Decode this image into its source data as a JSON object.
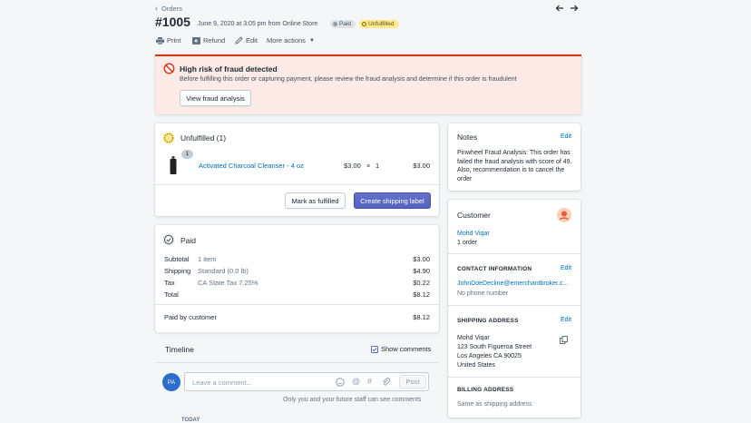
{
  "breadcrumb": {
    "label": "Orders"
  },
  "order": {
    "number": "#1005",
    "meta": "June 9, 2020 at 3:05 pm from Online Store",
    "badge_paid": "Paid",
    "badge_fulfillment": "Unfulfilled"
  },
  "actions": {
    "print": "Print",
    "refund": "Refund",
    "edit": "Edit",
    "more": "More actions"
  },
  "fraud": {
    "title": "High risk of fraud detected",
    "body": "Before fulfilling this order or capturing payment, please review the fraud analysis and determine if this order is fraudulent",
    "button": "View fraud analysis"
  },
  "unfulfilled": {
    "title": "Unfulfilled (1)",
    "item": {
      "qty_badge": "1",
      "name": "Activated Charcoal Cleanser - 4 oz",
      "price": "$3.00",
      "times": "×",
      "qty": "1",
      "total": "$3.00"
    },
    "mark_button": "Mark as fulfilled",
    "label_button": "Create shipping label"
  },
  "paid": {
    "title": "Paid",
    "rows": [
      {
        "label": "Subtotal",
        "detail": "1 item",
        "amount": "$3.00"
      },
      {
        "label": "Shipping",
        "detail": "Standard (0.0 lb)",
        "amount": "$4.90"
      },
      {
        "label": "Tax",
        "detail": "CA State Tax 7.25%",
        "amount": "$0.22"
      },
      {
        "label": "Total",
        "detail": "",
        "amount": "$8.12"
      }
    ],
    "paid_by_label": "Paid by customer",
    "paid_by_amount": "$8.12"
  },
  "timeline": {
    "title": "Timeline",
    "show_comments": "Show comments",
    "avatar": "PA",
    "placeholder": "Leave a comment...",
    "post": "Post",
    "hint": "Only you and your future staff can see comments",
    "today": "TODAY"
  },
  "notes": {
    "title": "Notes",
    "edit": "Edit",
    "text": "Pinwheel Fraud Analysis: This order has failed the fraud analysis with score of 49. Also, recommendation is to cancel the order"
  },
  "customer": {
    "title": "Customer",
    "name": "Mohd Viqar",
    "orders": "1 order",
    "contact_heading": "CONTACT INFORMATION",
    "contact_edit": "Edit",
    "email": "JohnDoeDecline@emerchantbroker.c...",
    "phone": "No phone number",
    "shipping_heading": "SHIPPING ADDRESS",
    "shipping_edit": "Edit",
    "address": [
      "Mohd Viqar",
      "123 South Figueroa Street",
      "Los Angeles CA 90025",
      "United States"
    ],
    "billing_heading": "BILLING ADDRESS",
    "billing": "Same as shipping address"
  },
  "colors": {
    "accent": "#5c6ac4",
    "danger": "#de3618",
    "link": "#006fbb",
    "warning_badge": "#ffea8a"
  }
}
